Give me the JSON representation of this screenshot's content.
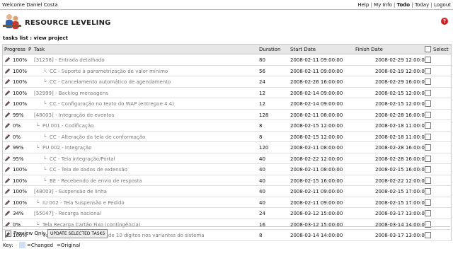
{
  "header": {
    "welcome": "Welcome Daniel Costa",
    "nav": [
      "Help",
      "My Info",
      "Todo",
      "Today",
      "Logout"
    ],
    "active_nav": "Todo"
  },
  "page": {
    "title": "RESOURCE LEVELING",
    "subtitle": "tasks list : view project",
    "help_icon": "?"
  },
  "columns": {
    "progress": "Progress",
    "priority": "P",
    "task": "Task",
    "duration": "Duration",
    "start": "Start Date",
    "finish": "Finish Date",
    "select": "Select"
  },
  "rows": [
    {
      "progress": "100%",
      "task": "[31258] - Entrada detalhado",
      "indent": 0,
      "duration": "80",
      "start": "2008-02-11 09:00:00",
      "finish": "2008-02-29 12:00:00"
    },
    {
      "progress": "100%",
      "task": "CC - Suporte à parametrização de valor mínimo",
      "indent": 2,
      "duration": "56",
      "start": "2008-02-11 09:00:00",
      "finish": "2008-02-19 12:00:00"
    },
    {
      "progress": "100%",
      "task": "CC - Cancelamento automático de agendamento",
      "indent": 2,
      "duration": "24",
      "start": "2008-02-26 16:00:00",
      "finish": "2008-02-29 16:00:00"
    },
    {
      "progress": "100%",
      "task": "[32999] - Backlog mensagens",
      "indent": 0,
      "duration": "12",
      "start": "2008-02-14 09:00:00",
      "finish": "2008-02-15 12:00:00"
    },
    {
      "progress": "100%",
      "task": "CC - Configuração no texto do WAP (entregue 4.4)",
      "indent": 2,
      "duration": "12",
      "start": "2008-02-14 09:00:00",
      "finish": "2008-02-15 12:00:00"
    },
    {
      "progress": "99%",
      "task": "[48003] - Integração de eventos",
      "indent": 0,
      "duration": "128",
      "start": "2008-02-11 08:00:00",
      "finish": "2008-02-28 16:00:00"
    },
    {
      "progress": "0%",
      "task": "PU 001 - Codificação",
      "indent": 1,
      "duration": "8",
      "start": "2008-02-15 12:00:00",
      "finish": "2008-02-18 11:00:00"
    },
    {
      "progress": "0%",
      "task": "CC - Alteração da tela de conformação",
      "indent": 2,
      "duration": "8",
      "start": "2008-02-15 12:00:00",
      "finish": "2008-02-18 11:00:00"
    },
    {
      "progress": "99%",
      "task": "PU 002 - Integração",
      "indent": 1,
      "duration": "120",
      "start": "2008-02-11 08:00:00",
      "finish": "2008-02-28 16:00:00"
    },
    {
      "progress": "95%",
      "task": "CC - Tela integração/Portal",
      "indent": 2,
      "duration": "40",
      "start": "2008-02-22 12:00:00",
      "finish": "2008-02-28 16:00:00"
    },
    {
      "progress": "100%",
      "task": "CC - Tela de dados de extensão",
      "indent": 2,
      "duration": "40",
      "start": "2008-02-11 08:00:00",
      "finish": "2008-02-15 16:00:00"
    },
    {
      "progress": "100%",
      "task": "BE - Recebendo de envio de resposta",
      "indent": 2,
      "duration": "40",
      "start": "2008-02-15 16:00:00",
      "finish": "2008-02-22 12:00:00"
    },
    {
      "progress": "100%",
      "task": "[48003] - Suspensão de linha",
      "indent": 0,
      "duration": "40",
      "start": "2008-02-11 09:00:00",
      "finish": "2008-02-15 17:00:00"
    },
    {
      "progress": "100%",
      "task": "IU 002 - Tela Suspensão e Pedido",
      "indent": 1,
      "duration": "40",
      "start": "2008-02-11 09:00:00",
      "finish": "2008-02-15 17:00:00"
    },
    {
      "progress": "34%",
      "task": "[55047] - Recarga nacional",
      "indent": 0,
      "duration": "24",
      "start": "2008-03-12 15:00:00",
      "finish": "2008-03-17 13:00:00"
    },
    {
      "progress": "0%",
      "task": "Tela Recarga Cartão Fixo (contingência)",
      "indent": 1,
      "duration": "16",
      "start": "2008-03-12 15:00:00",
      "finish": "2008-03-14 14:00:00"
    },
    {
      "progress": "100%",
      "task": "Verificar impacto dos pins de 10 dígitos nos variantes do sistema",
      "indent": 1,
      "duration": "8",
      "start": "2008-03-14 14:00:00",
      "finish": "2008-03-17 13:00:00"
    }
  ],
  "bottom": {
    "preview_label": "Preview Only",
    "update_button": "UPDATE SELECTED TASKS"
  },
  "key": {
    "label": "Key:",
    "changed": "=Changed",
    "original": "=Original",
    "changed_color": "#cfe0f4"
  }
}
